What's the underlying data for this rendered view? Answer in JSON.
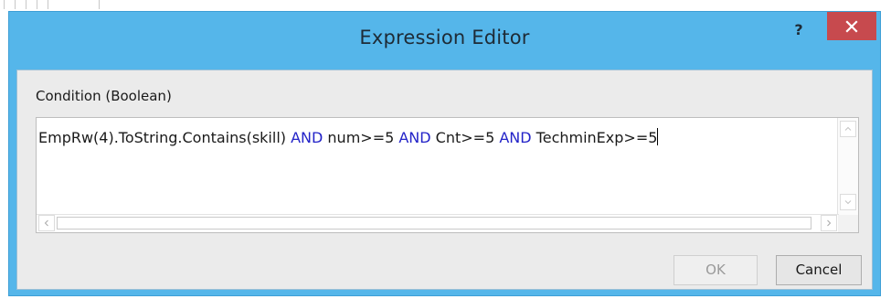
{
  "window": {
    "title": "Expression Editor",
    "help_label": "?",
    "close_label": "×"
  },
  "editor": {
    "label": "Condition (Boolean)",
    "tokens": [
      {
        "text": "EmpRw(4).ToString.Contains(skill) ",
        "keyword": false
      },
      {
        "text": "AND",
        "keyword": true
      },
      {
        "text": " num>=5 ",
        "keyword": false
      },
      {
        "text": "AND",
        "keyword": true
      },
      {
        "text": " Cnt>=5 ",
        "keyword": false
      },
      {
        "text": "AND",
        "keyword": true
      },
      {
        "text": " TechminExp>=5",
        "keyword": false
      }
    ],
    "keyword_color": "#2323c8"
  },
  "buttons": {
    "ok_label": "OK",
    "ok_enabled": false,
    "cancel_label": "Cancel"
  },
  "colors": {
    "titlebar": "#55b6ea",
    "close_button": "#c74a4e",
    "client_bg": "#ebebeb"
  }
}
